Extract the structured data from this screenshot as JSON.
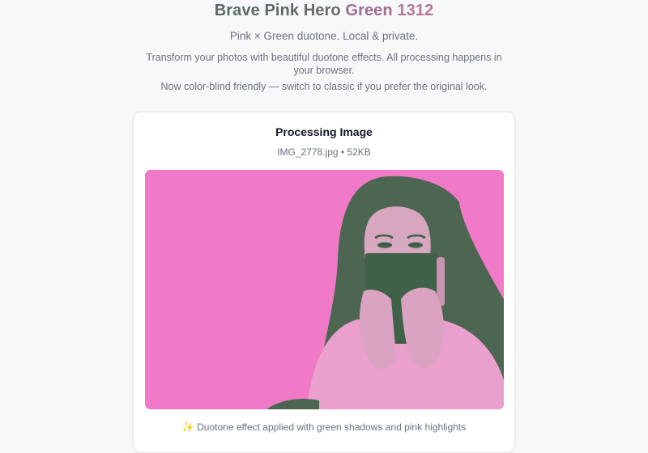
{
  "header": {
    "title_parts": [
      "Brave Pink",
      "Hero",
      "Green",
      "1312"
    ],
    "title_colors": {
      "dark": "#5b6b63",
      "pink": "#b2799a"
    },
    "subtitle": "Pink × Green duotone. Local & private.",
    "description": "Transform your photos with beautiful duotone effects. All processing happens in your browser.",
    "note": "Now color-blind friendly — switch to classic if you prefer the original look."
  },
  "card": {
    "title": "Processing Image",
    "file_info": "IMG_2778.jpg • 52KB",
    "image": {
      "effect": "duotone",
      "highlight_color": "#f07ac8",
      "shadow_color": "#3d5f46"
    },
    "caption": "✨ Duotone effect applied with green shadows and pink highlights"
  }
}
